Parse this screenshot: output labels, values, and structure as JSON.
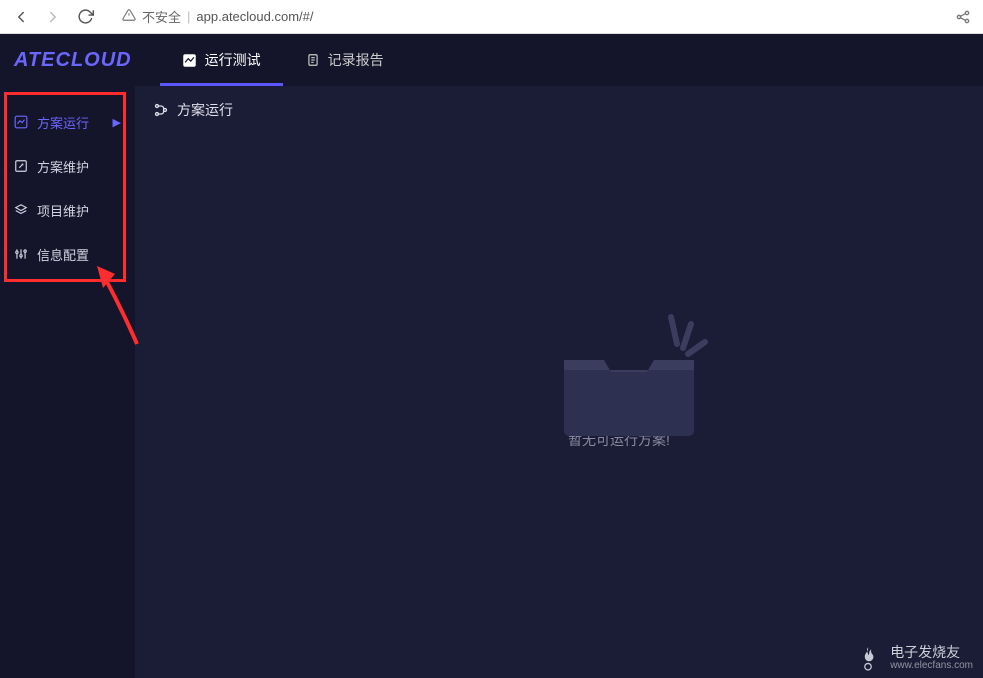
{
  "browser": {
    "security_label": "不安全",
    "url": "app.atecloud.com/#/"
  },
  "logo": "ATECLOUD",
  "tabs": [
    {
      "label": "运行测试",
      "icon": "chart-line-icon",
      "active": true
    },
    {
      "label": "记录报告",
      "icon": "clipboard-icon",
      "active": false
    }
  ],
  "sidebar": [
    {
      "label": "方案运行",
      "icon": "chart-line-icon",
      "active": true,
      "has_arrow": true
    },
    {
      "label": "方案维护",
      "icon": "edit-square-icon",
      "active": false,
      "has_arrow": false
    },
    {
      "label": "项目维护",
      "icon": "layers-icon",
      "active": false,
      "has_arrow": false
    },
    {
      "label": "信息配置",
      "icon": "sliders-icon",
      "active": false,
      "has_arrow": false
    }
  ],
  "breadcrumb": {
    "icon": "fork-icon",
    "title": "方案运行"
  },
  "empty_state": {
    "message": "暂无可运行方案!"
  },
  "watermark": {
    "line1": "电子发烧友",
    "line2": "www.elecfans.com"
  },
  "colors": {
    "accent": "#6b66ff",
    "annotation": "#ff2d2d",
    "bg_dark": "#14152b",
    "bg_panel": "#1b1c36"
  }
}
